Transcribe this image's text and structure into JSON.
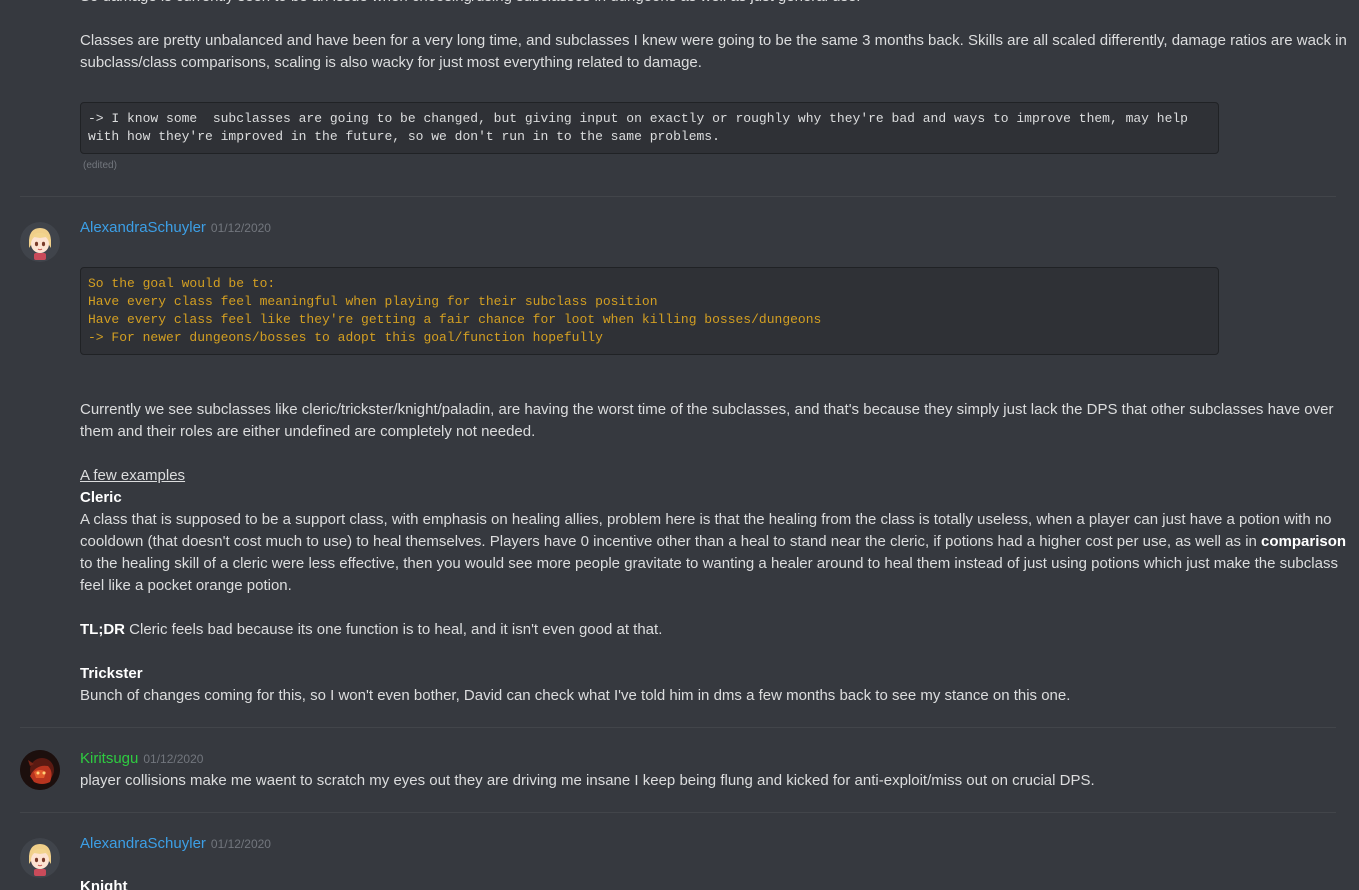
{
  "colors": {
    "background": "#36393f",
    "text": "#dcddde",
    "code_bg": "#2f3136",
    "username_alexandra": "#3c9fe6",
    "username_kiritsugu": "#2ecc40",
    "code_orange": "#d39f22",
    "timestamp": "#72767d"
  },
  "msg0": {
    "top_line": "So damage is currently seen to be an issue when choosing/using subclasses in dungeons as well as just general use.",
    "para1_line1": "Classes are pretty unbalanced and have been for a very long time, and subclasses I knew were going to be the same 3 months back. Skills are all scaled differently, damage ratios are wack in",
    "para1_line2": "subclass/class comparisons, scaling is also wacky for just most everything related to damage.",
    "code_line1": "-> I know some  subclasses are going to be changed, but giving input on exactly or roughly why they're bad and ways to improve them, may help",
    "code_line2": "with how they're improved in the future, so we don't run in to the same problems.",
    "edited": "(edited)"
  },
  "msg1": {
    "author": "AlexandraSchuyler",
    "timestamp": "01/12/2020",
    "avatar_icon": "anime-girl-avatar-icon",
    "code_line1": "So the goal would be to:",
    "code_line2": "Have every class feel meaningful when playing for their subclass position",
    "code_line3": "Have every class feel like they're getting a fair chance for loot when killing bosses/dungeons",
    "code_line4": "-> For newer dungeons/bosses to adopt this goal/function hopefully",
    "p1_line1": "Currently we see subclasses like cleric/trickster/knight/paladin, are having the worst time of the subclasses, and that's because they simply just lack the DPS that other subclasses have over",
    "p1_line2": "them and their roles are either undefined are completely not needed.",
    "examples_heading": "A few examples",
    "cleric_heading": "Cleric",
    "cleric_line1": "A class that is supposed to be a support class, with emphasis on healing allies, problem here is that the healing from the class is totally useless, when a player can just have a potion with no",
    "cleric_line2_pre": "cooldown (that doesn't cost much to use) to heal themselves. Players have 0 incentive other than a heal to stand near the cleric, if potions had a higher cost per use, as well as in ",
    "cleric_line2_bold": "comparison",
    "cleric_line3": "to the healing skill of a cleric were less effective, then you would see more people gravitate to wanting a healer around to heal them instead of just using potions which just make the subclass",
    "cleric_line4": "feel like a pocket orange potion.",
    "tldr_bold": "TL;DR",
    "tldr_text": " Cleric feels bad because its one function is to heal, and it isn't even good at that.",
    "trickster_heading": "Trickster",
    "trickster_line": "Bunch of changes coming for this, so I won't even bother, David can check what I've told him in dms a few months back to see my stance on this one."
  },
  "msg2": {
    "author": "Kiritsugu",
    "timestamp": "01/12/2020",
    "avatar_icon": "red-character-avatar-icon",
    "text": "player collisions make me waent to scratch my eyes out they are driving me insane I keep being flung and kicked for anti-exploit/miss out on crucial DPS."
  },
  "msg3": {
    "author": "AlexandraSchuyler",
    "timestamp": "01/12/2020",
    "avatar_icon": "anime-girl-avatar-icon",
    "heading": "Knight"
  }
}
